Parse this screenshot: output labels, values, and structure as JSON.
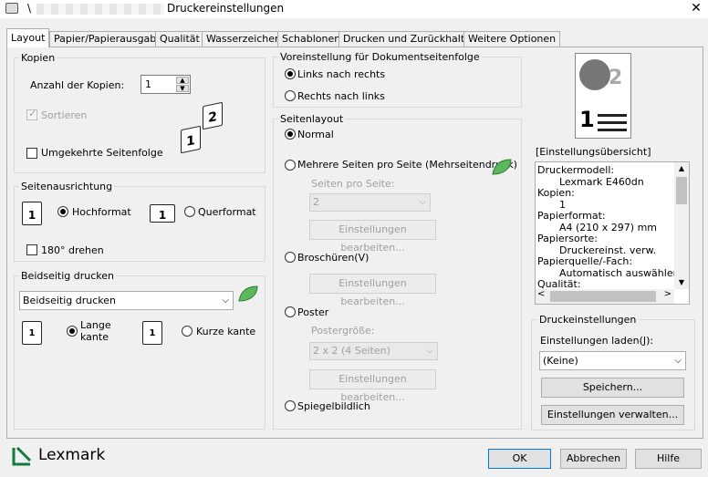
{
  "window": {
    "title": "Druckereinstellungen",
    "title_prefix": "\\",
    "close_glyph": "✕"
  },
  "tabs": [
    {
      "label": "Layout"
    },
    {
      "label": "Papier/Papierausgabe"
    },
    {
      "label": "Qualität"
    },
    {
      "label": "Wasserzeichen"
    },
    {
      "label": "Schablonen"
    },
    {
      "label": "Drucken und Zurückhalten"
    },
    {
      "label": "Weitere Optionen"
    }
  ],
  "copies": {
    "group_label": "Kopien",
    "count_label": "Anzahl der Kopien:",
    "count_value": "1",
    "collate_label": "Sortieren",
    "reverse_label": "Umgekehrte Seitenfolge"
  },
  "orientation": {
    "group_label": "Seitenausrichtung",
    "portrait_label": "Hochformat",
    "landscape_label": "Querformat",
    "rotate_label": "180° drehen"
  },
  "duplex": {
    "group_label": "Beidseitig drucken",
    "select_value": "Beidseitig drucken",
    "long_label": "Lange\nkante",
    "short_label": "Kurze kante"
  },
  "doc_order": {
    "group_label": "Voreinstellung für Dokumentseitenfolge",
    "ltr_label": "Links nach rechts",
    "rtl_label": "Rechts nach links"
  },
  "page_layout": {
    "group_label": "Seitenlayout",
    "normal_label": "Normal",
    "multi_label": "Mehrere Seiten pro Seite (Mehrseitendruck)",
    "pages_per_sheet_label": "Seiten pro Seite:",
    "pages_per_sheet_value": "2",
    "edit_label_1": "Einstellungen bearbeiten...",
    "booklet_label": "Broschüren(V)",
    "edit_label_2": "Einstellungen bearbeiten...",
    "poster_label": "Poster",
    "poster_size_label": "Postergröße:",
    "poster_size_value": "2 x 2 (4 Seiten)",
    "edit_label_3": "Einstellungen bearbeiten...",
    "mirror_label": "Spiegelbildlich"
  },
  "summary": {
    "label": "[Einstellungsübersicht]",
    "lines": [
      {
        "text": "Druckermodell:",
        "indent": false
      },
      {
        "text": "Lexmark E460dn",
        "indent": true
      },
      {
        "text": "Kopien:",
        "indent": false
      },
      {
        "text": "1",
        "indent": true
      },
      {
        "text": "Papierformat:",
        "indent": false
      },
      {
        "text": "A4 (210 x 297) mm",
        "indent": true
      },
      {
        "text": "Papiersorte:",
        "indent": false
      },
      {
        "text": "Druckereinst. verw.",
        "indent": true
      },
      {
        "text": "Papierquelle/-Fach:",
        "indent": false
      },
      {
        "text": "Automatisch auswählen",
        "indent": true
      },
      {
        "text": "Qualität:",
        "indent": false
      }
    ]
  },
  "print_settings": {
    "group_label": "Druckeinstellungen",
    "load_label": "Einstellungen laden(J):",
    "load_value": "(Keine)",
    "save_label": "Speichern...",
    "manage_label": "Einstellungen verwalten..."
  },
  "footer": {
    "brand": "Lexmark",
    "ok": "OK",
    "cancel": "Abbrechen",
    "help": "Hilfe"
  },
  "colors": {
    "brand_green": "#107c41",
    "eco_leaf": "#4caf50",
    "accent_blue": "#0078d7"
  }
}
